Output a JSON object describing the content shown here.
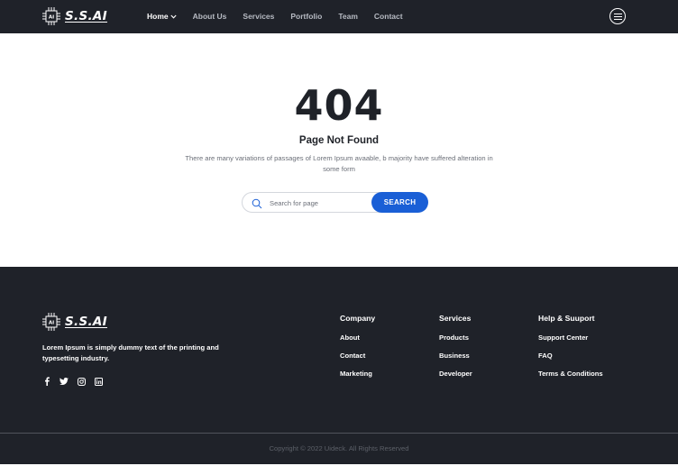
{
  "header": {
    "logo_text": "S.S.AI",
    "logo_chip_text": "AI",
    "nav": [
      {
        "label": "Home",
        "active": true,
        "has_dropdown": true
      },
      {
        "label": "About Us",
        "active": false
      },
      {
        "label": "Services",
        "active": false
      },
      {
        "label": "Portfolio",
        "active": false
      },
      {
        "label": "Team",
        "active": false
      },
      {
        "label": "Contact",
        "active": false
      }
    ],
    "menu_icon": "hamburger-menu-icon"
  },
  "main": {
    "error_code": "404",
    "title": "Page Not Found",
    "description": "There are many variations of passages of Lorem Ipsum avaable, b majority have suffered alteration in some form",
    "search": {
      "placeholder": "Search for page",
      "value": "",
      "button_label": "SEARCH",
      "icon": "search-icon"
    }
  },
  "footer": {
    "logo_text": "S.S.AI",
    "logo_chip_text": "AI",
    "tagline": "Lorem Ipsum is simply dummy text of the printing and typesetting industry.",
    "socials": [
      "facebook-icon",
      "twitter-icon",
      "instagram-icon",
      "linkedin-icon"
    ],
    "columns": [
      {
        "title": "Company",
        "links": [
          "About",
          "Contact",
          "Marketing"
        ]
      },
      {
        "title": "Services",
        "links": [
          "Products",
          "Business",
          "Developer"
        ]
      },
      {
        "title": "Help & Suuport",
        "links": [
          "Support Center",
          "FAQ",
          "Terms & Conditions"
        ]
      }
    ],
    "copyright": "Copyright © 2022 Uideck. All Rights Reserved"
  },
  "colors": {
    "dark_background": "#1f2229",
    "accent_blue": "#1a5fd6",
    "nav_inactive": "#b7bbc3",
    "white": "#ffffff"
  }
}
